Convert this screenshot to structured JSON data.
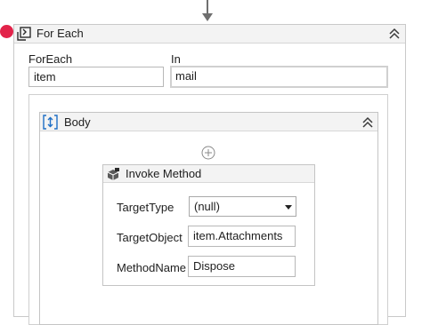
{
  "foreach": {
    "title": "For Each",
    "foreach_label": "ForEach",
    "foreach_value": "item",
    "in_label": "In",
    "in_value": "mail"
  },
  "body": {
    "title": "Body"
  },
  "invoke": {
    "title": "Invoke Method",
    "target_type_label": "TargetType",
    "target_type_value": "(null)",
    "target_object_label": "TargetObject",
    "target_object_value": "item.Attachments",
    "method_name_label": "MethodName",
    "method_name_value": "Dispose"
  },
  "colors": {
    "breakpoint": "#e2234a",
    "accent_blue": "#1f6fc5",
    "header_bg": "#f3f3f3",
    "border": "#c9c9c9"
  },
  "icons": {
    "foreach": "foreach-loop-icon",
    "collapse": "double-chevron-up-icon",
    "body": "sequence-body-icon",
    "add": "add-activity-icon",
    "invoke": "invoke-method-icon",
    "dropdown": "dropdown-arrow-icon"
  }
}
